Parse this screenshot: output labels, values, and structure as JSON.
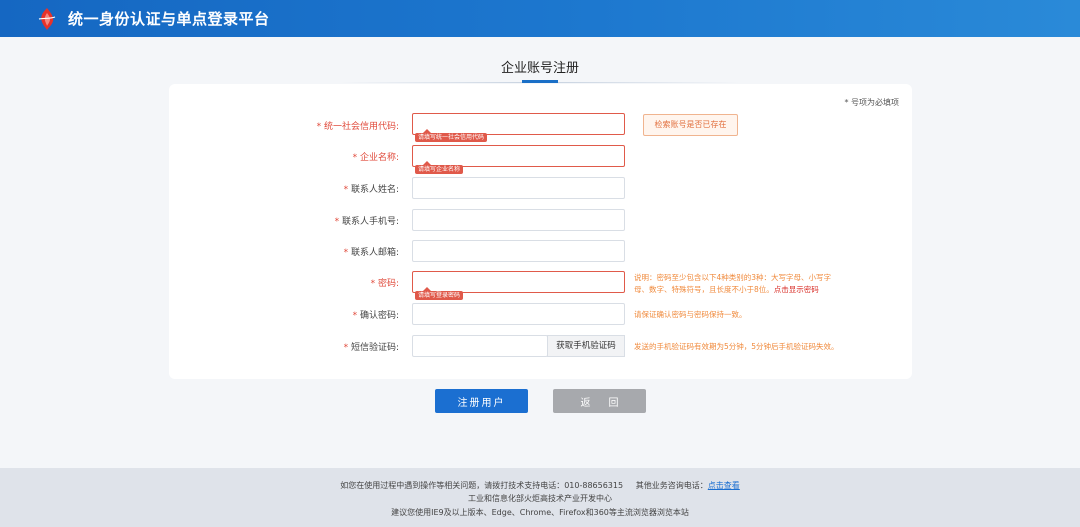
{
  "header": {
    "title": "统一身份认证与单点登录平台",
    "logo_icon": "torch-logo",
    "color": "#1a6fc7"
  },
  "page": {
    "title": "企业账号注册",
    "required_note": "* 号项为必填项"
  },
  "form": {
    "fields": [
      {
        "label": "统一社会信用代码:",
        "required": true,
        "error": true,
        "value": "",
        "tip": "请填写统一社会信用代码"
      },
      {
        "label": "企业名称:",
        "required": true,
        "error": true,
        "value": "",
        "tip": "请填写企业名称"
      },
      {
        "label": "联系人姓名:",
        "required": true,
        "error": false,
        "value": ""
      },
      {
        "label": "联系人手机号:",
        "required": true,
        "error": false,
        "value": ""
      },
      {
        "label": "联系人邮箱:",
        "required": true,
        "error": false,
        "value": ""
      },
      {
        "label": "密码:",
        "required": true,
        "error": true,
        "value": "",
        "tip": "请填写登录密码"
      },
      {
        "label": "确认密码:",
        "required": true,
        "error": false,
        "value": ""
      },
      {
        "label": "短信验证码:",
        "required": true,
        "error": false,
        "value": ""
      }
    ],
    "check_account_button": "检索账号是否已存在",
    "password_hint_1": "说明：密码至少包含以下4种类别的3种：大写字母、小写字",
    "password_hint_2": "母、数字、特殊符号，且长度不小于8位。",
    "password_hint_link": "点击显示密码",
    "confirm_hint": "请保证确认密码与密码保持一致。",
    "sms_button": "获取手机验证码",
    "sms_hint": "发送的手机验证码有效期为5分钟，5分钟后手机验证码失效。"
  },
  "actions": {
    "register": "注册用户",
    "back": "返回"
  },
  "footer": {
    "support_text": "如您在使用过程中遇到操作等相关问题，请拨打技术支持电话：010-88656315",
    "business_text": "其他业务咨询电话：",
    "business_link": "点击查看",
    "org": "工业和信息化部火炬高技术产业开发中心",
    "browser_note": "建议您使用IE9及以上版本、Edge、Chrome、Firefox和360等主流浏览器浏览本站"
  },
  "colors": {
    "primary": "#1b6fd1",
    "error": "#e0594a",
    "hint": "#f08a3c",
    "back_button": "#a7a9ad"
  }
}
